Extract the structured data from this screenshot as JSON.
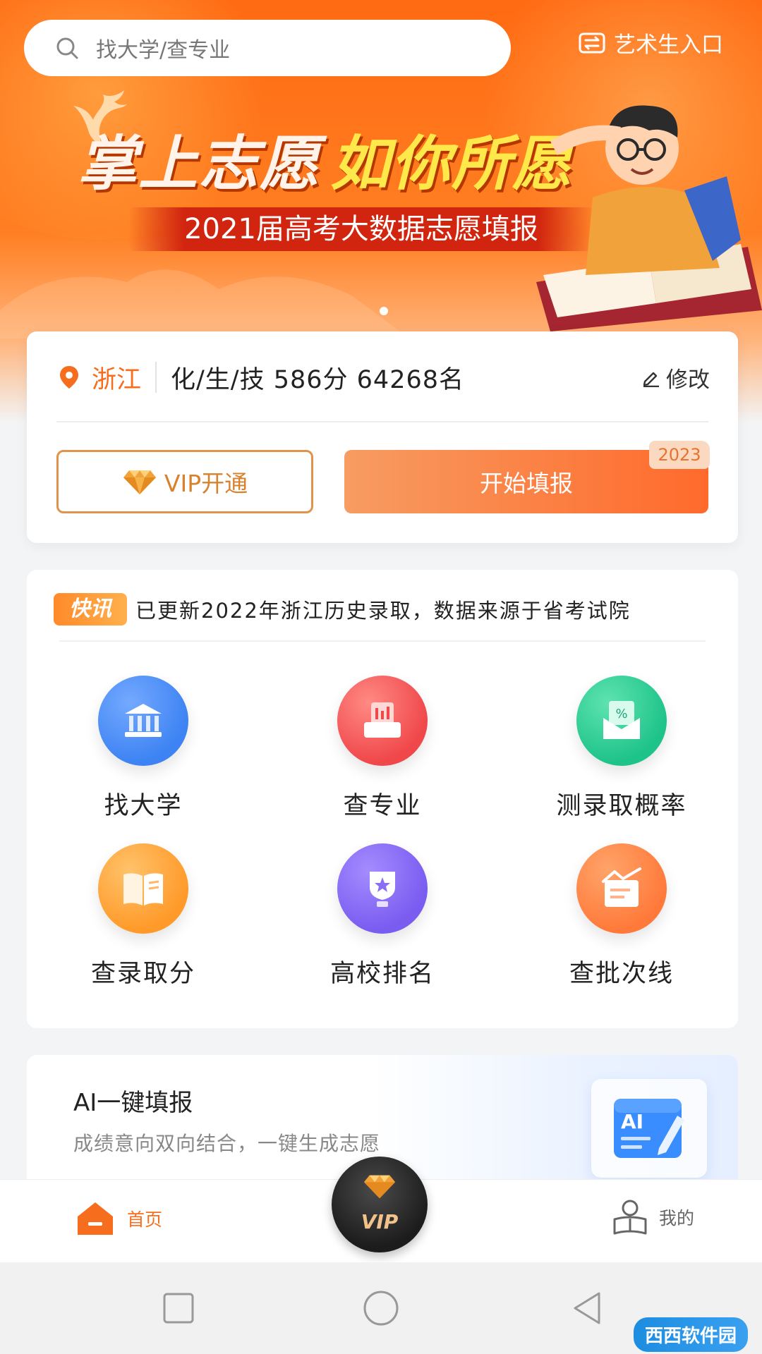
{
  "search": {
    "placeholder": "找大学/查专业"
  },
  "art_entry": {
    "label": "艺术生入口"
  },
  "banner": {
    "headline_a": "掌上志愿",
    "headline_b": "如你所愿",
    "subtitle": "2021届高考大数据志愿填报"
  },
  "score_card": {
    "province": "浙江",
    "info": "化/生/技 586分 64268名",
    "edit_label": "修改",
    "vip_button": "VIP开通",
    "start_button": "开始填报",
    "year_badge": "2023"
  },
  "news": {
    "tag": "快讯",
    "text": "已更新2022年浙江历史录取，数据来源于省考试院"
  },
  "tools": [
    {
      "label": "找大学",
      "icon": "university-icon",
      "color": "#3d83f3"
    },
    {
      "label": "查专业",
      "icon": "major-icon",
      "color": "#f0474a"
    },
    {
      "label": "测录取概率",
      "icon": "probability-icon",
      "color": "#1ec38a"
    },
    {
      "label": "查录取分",
      "icon": "score-book-icon",
      "color": "#ff9a2a"
    },
    {
      "label": "高校排名",
      "icon": "ranking-icon",
      "color": "#7a5cf0"
    },
    {
      "label": "查批次线",
      "icon": "batch-line-icon",
      "color": "#ff7a3a"
    }
  ],
  "ai_card": {
    "title": "AI一键填报",
    "subtitle": "成绩意向双向结合，一键生成志愿",
    "icon_text": "AI"
  },
  "tabbar": {
    "home": "首页",
    "vip": "VIP",
    "mine": "我的"
  },
  "watermark": "西西软件园",
  "colors": {
    "accent": "#f56d1d",
    "banner": "#ff6a12"
  }
}
